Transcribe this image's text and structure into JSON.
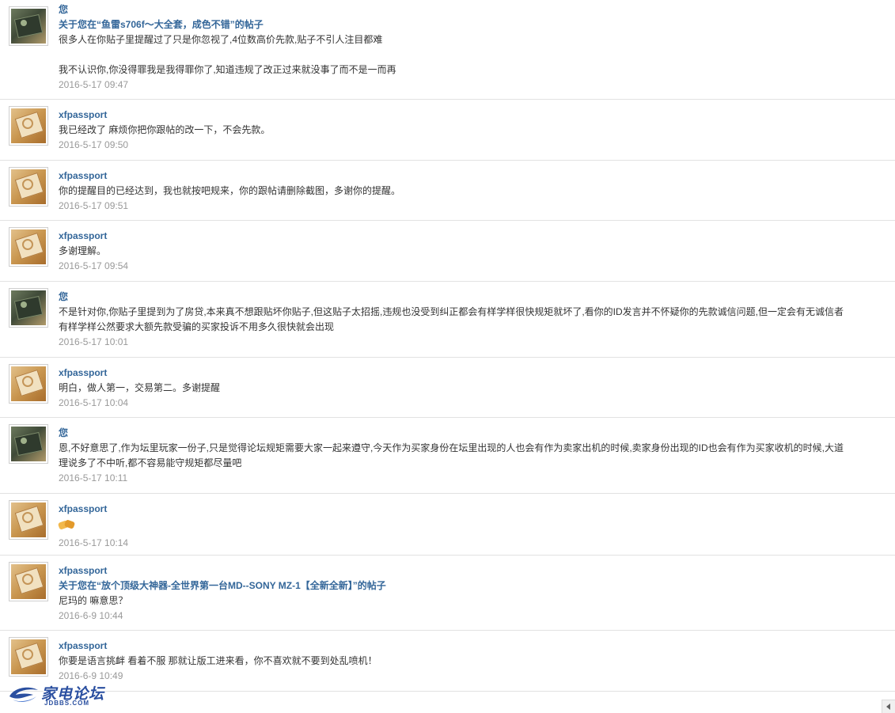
{
  "messages": [
    {
      "author": "您",
      "avatar": "console-avatar",
      "subject": "关于您在“鱼雷s706f～大全套，成色不错”的帖子",
      "text": "很多人在你贴子里提醒过了只是你忽视了,4位数高价先款,贴子不引人注目都难\n\n我不认识你,你没得罪我是我得罪你了,知道违规了改正过来就没事了而不是一而再",
      "time": "2016-5-17 09:47"
    },
    {
      "author": "xfpassport",
      "avatar": "cd-player-avatar",
      "text": "我已经改了 麻烦你把你跟帖的改一下，不会先款。",
      "time": "2016-5-17 09:50"
    },
    {
      "author": "xfpassport",
      "avatar": "cd-player-avatar",
      "text": "你的提醒目的已经达到，我也就按吧规来，你的跟帖请删除截图，多谢你的提醒。",
      "time": "2016-5-17 09:51"
    },
    {
      "author": "xfpassport",
      "avatar": "cd-player-avatar",
      "text": "多谢理解。",
      "time": "2016-5-17 09:54"
    },
    {
      "author": "您",
      "avatar": "console-avatar",
      "text": "不是针对你,你贴子里提到为了房贷,本来真不想跟贴坏你贴子,但这贴子太招摇,违规也没受到纠正都会有样学样很快规矩就坏了,看你的ID发言并不怀疑你的先款诚信问题,但一定会有无诚信者\n有样学样公然要求大额先款受骗的买家投诉不用多久很快就会出现",
      "time": "2016-5-17 10:01"
    },
    {
      "author": "xfpassport",
      "avatar": "cd-player-avatar",
      "text": "明白，做人第一，交易第二。多谢提醒",
      "time": "2016-5-17 10:04"
    },
    {
      "author": "您",
      "avatar": "console-avatar",
      "text": "恩,不好意思了,作为坛里玩家一份子,只是觉得论坛规矩需要大家一起来遵守,今天作为买家身份在坛里出现的人也会有作为卖家出机的时候,卖家身份出现的ID也会有作为买家收机的时候,大道\n理说多了不中听,都不容易能守规矩都尽量吧",
      "time": "2016-5-17 10:11"
    },
    {
      "author": "xfpassport",
      "avatar": "cd-player-avatar",
      "emoji": "handshake-emoji",
      "time": "2016-5-17 10:14"
    },
    {
      "author": "xfpassport",
      "avatar": "cd-player-avatar",
      "subject": "关于您在“放个顶级大神器-全世界第一台MD--SONY MZ-1【全新全新】”的帖子",
      "text": "尼玛的 嘛意思？",
      "time": "2016-6-9 10:44"
    },
    {
      "author": "xfpassport",
      "avatar": "cd-player-avatar",
      "text": "你要是语言挑衅 看着不服 那就让版工进来看，你不喜欢就不要到处乱喷机！",
      "time": "2016-6-9 10:49"
    }
  ],
  "watermark": {
    "brand": "家电论坛",
    "domain": "JDBBS.COM",
    "icon": "swirl-logo-icon"
  },
  "scrollbar": {
    "icon": "scroll-left-arrow-icon"
  }
}
